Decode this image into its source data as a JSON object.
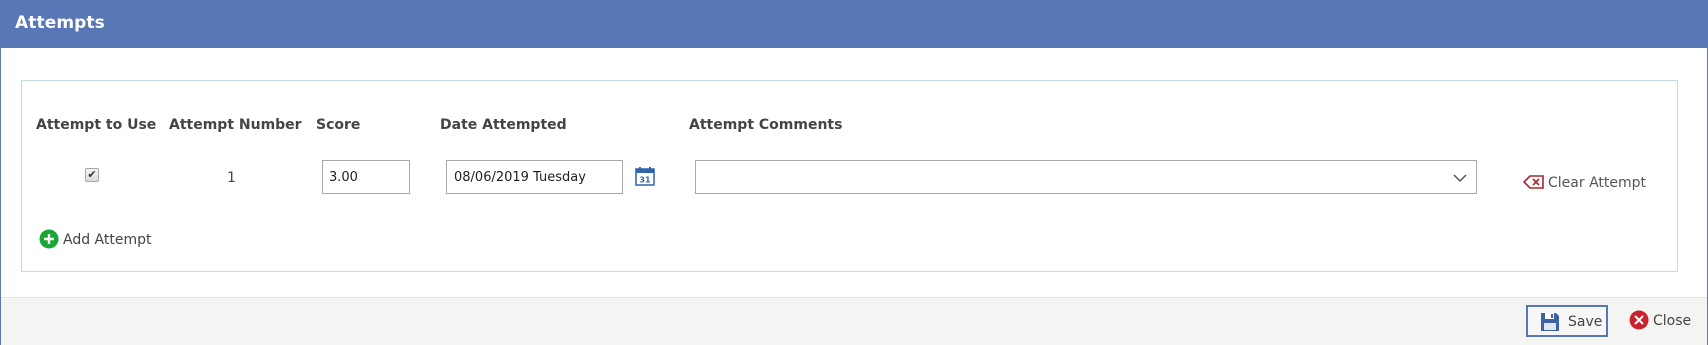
{
  "dialog": {
    "title": "Attempts"
  },
  "columns": {
    "attempt_to_use": "Attempt to Use",
    "attempt_number": "Attempt Number",
    "score": "Score",
    "date_attempted": "Date Attempted",
    "attempt_comments": "Attempt Comments"
  },
  "row": {
    "use_checked": true,
    "attempt_number": "1",
    "score": "3.00",
    "date": "08/06/2019 Tuesday",
    "comments": "",
    "clear_label": "Clear Attempt"
  },
  "actions": {
    "add_attempt": "Add Attempt",
    "save": "Save",
    "close": "Close"
  },
  "icons": {
    "calendar": "calendar-icon",
    "dropdown": "chevron-down-icon",
    "clear": "backspace-icon",
    "add": "plus-circle-icon",
    "save": "floppy-disk-icon",
    "close": "close-circle-icon"
  },
  "colors": {
    "header": "#5877b6",
    "add_icon": "#1aa632",
    "close_icon": "#c8232c",
    "clear_icon": "#a4262c",
    "save_icon": "#3f62a3"
  }
}
